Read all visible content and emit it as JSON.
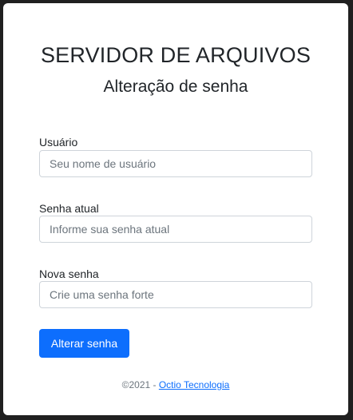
{
  "header": {
    "title": "SERVIDOR DE ARQUIVOS",
    "subtitle": "Alteração de senha"
  },
  "form": {
    "username": {
      "label": "Usuário",
      "placeholder": "Seu nome de usuário",
      "value": ""
    },
    "current_password": {
      "label": "Senha atual",
      "placeholder": "Informe sua senha atual",
      "value": ""
    },
    "new_password": {
      "label": "Nova senha",
      "placeholder": "Crie uma senha forte",
      "value": ""
    },
    "submit_label": "Alterar senha"
  },
  "footer": {
    "copyright": "©2021 - ",
    "link_text": "Octio Tecnologia"
  },
  "colors": {
    "primary": "#0d6efd",
    "background": "#202020",
    "card": "#ffffff"
  }
}
